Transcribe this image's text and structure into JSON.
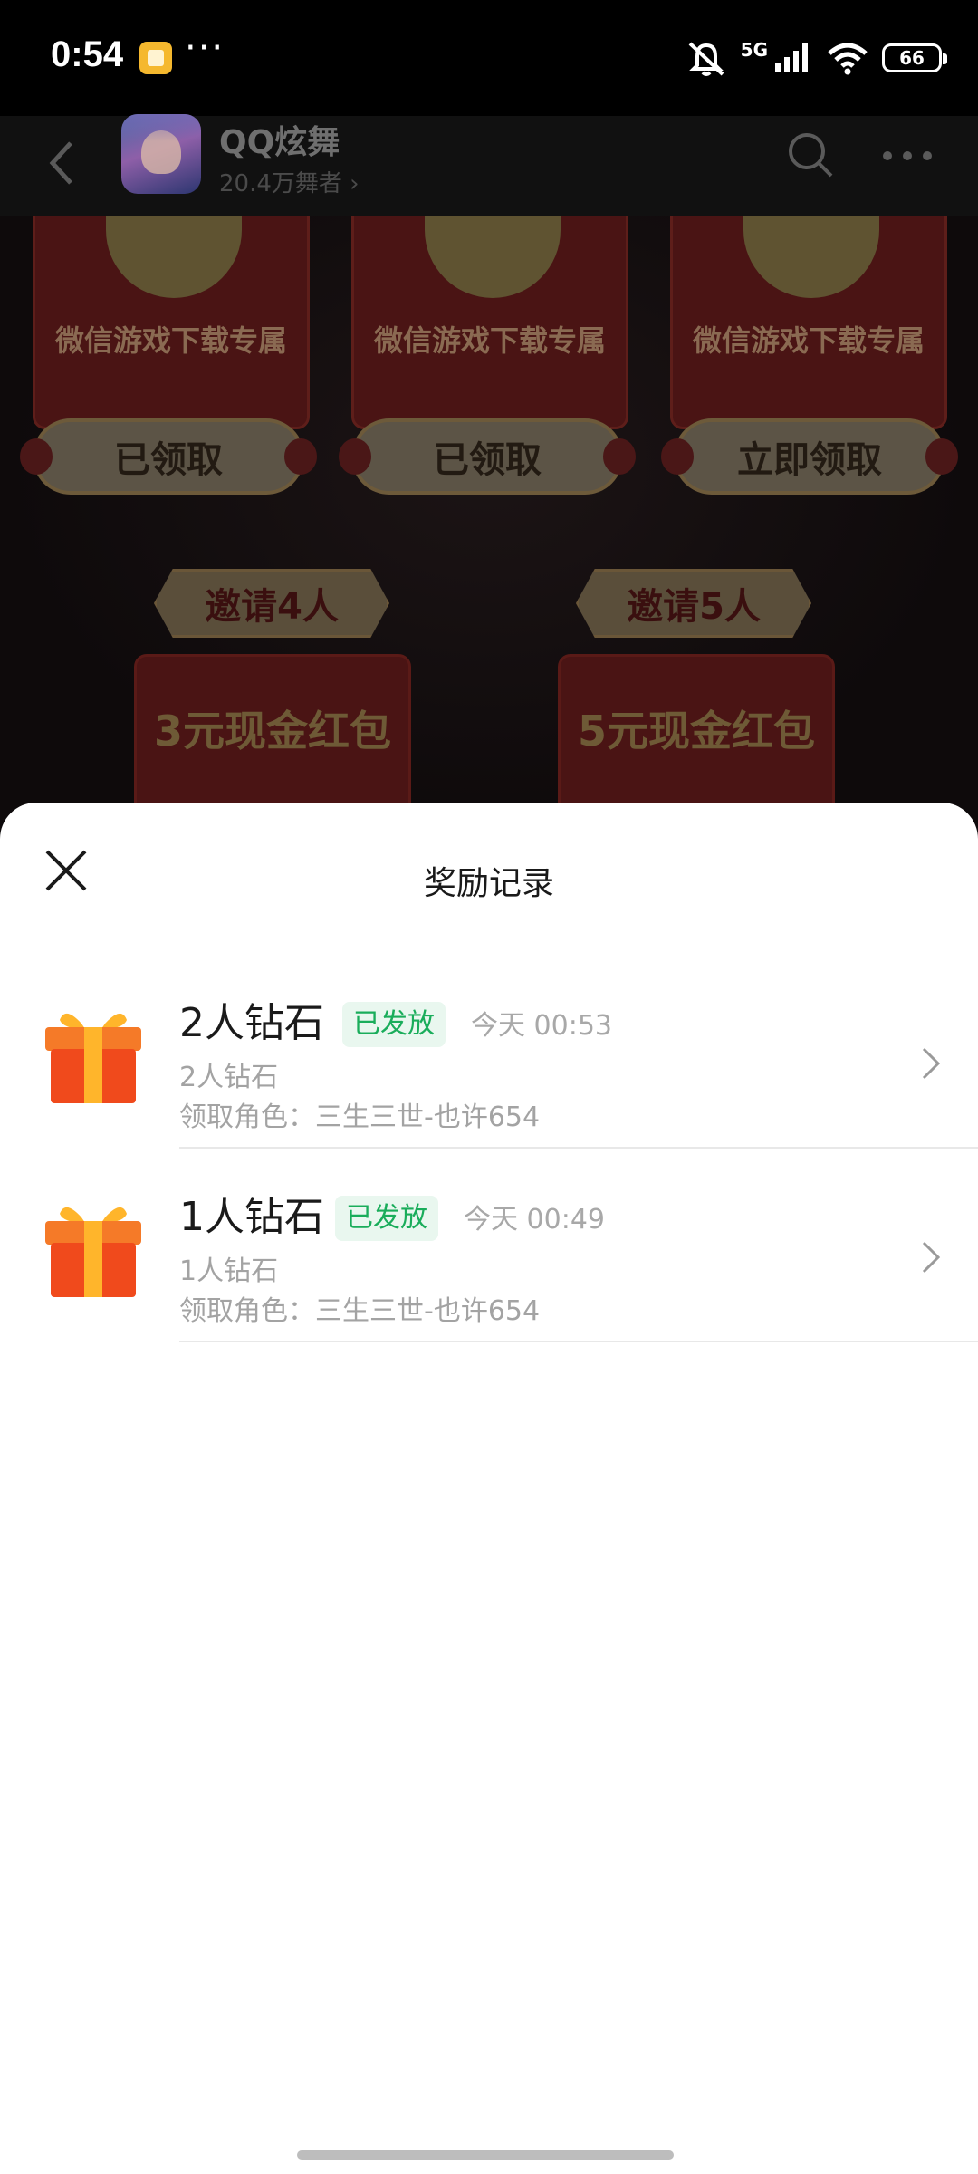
{
  "status_bar": {
    "time": "0:54",
    "dots": "···",
    "network": "5G",
    "battery": "66"
  },
  "top_nav": {
    "app_name": "QQ炫舞",
    "fans": "20.4万舞者 ›"
  },
  "background": {
    "cards": [
      {
        "text": "微信游戏下载专属",
        "button": "已领取"
      },
      {
        "text": "微信游戏下载专属",
        "button": "已领取"
      },
      {
        "text": "微信游戏下载专属",
        "button": "立即领取"
      }
    ],
    "invites": [
      {
        "banner": "邀请4人",
        "reward": "3元现金红包"
      },
      {
        "banner": "邀请5人",
        "reward": "5元现金红包"
      }
    ]
  },
  "sheet": {
    "title": "奖励记录",
    "records": [
      {
        "title": "2人钻石",
        "badge": "已发放",
        "time": "今天 00:53",
        "sub": "2人钻石",
        "role": "领取角色：三生三世-也许654"
      },
      {
        "title": "1人钻石",
        "badge": "已发放",
        "time": "今天 00:49",
        "sub": "1人钻石",
        "role": "领取角色：三生三世-也许654"
      }
    ]
  },
  "colors": {
    "badge_green": "#1aad5b",
    "badge_bg": "#e9f7ef",
    "gift_red": "#f04a1c",
    "gift_orange": "#ffb52b"
  }
}
